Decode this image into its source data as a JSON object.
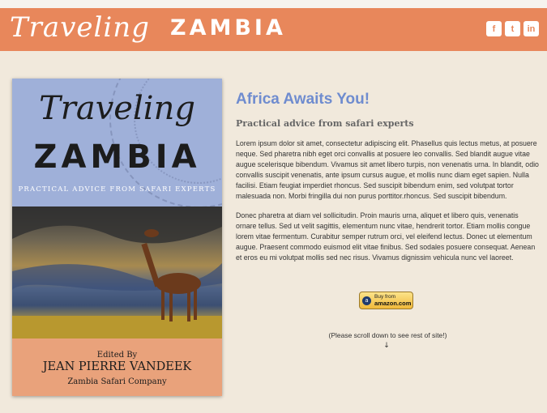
{
  "header": {
    "script_title": "Traveling",
    "title": "ZAMBIA",
    "social": [
      {
        "icon": "facebook-icon",
        "glyph": "f"
      },
      {
        "icon": "twitter-icon",
        "glyph": "t"
      },
      {
        "icon": "linkedin-icon",
        "glyph": "in"
      }
    ]
  },
  "book": {
    "script_title": "Traveling",
    "title": "ZAMBIA",
    "subtitle": "PRACTICAL ADVICE FROM SAFARI EXPERTS",
    "edited_by": "Edited By",
    "author": "JEAN PIERRE VANDEEK",
    "company": "Zambia Safari Company"
  },
  "main": {
    "heading": "Africa Awaits You!",
    "subheading": "Practical advice from safari experts",
    "paragraphs": [
      "Lorem ipsum dolor sit amet, consectetur adipiscing elit. Phasellus quis lectus metus, at posuere neque. Sed pharetra nibh eget orci convallis at posuere leo convallis. Sed blandit augue vitae augue scelerisque bibendum. Vivamus sit amet libero turpis, non venenatis urna. In blandit, odio convallis suscipit venenatis, ante ipsum cursus augue, et mollis nunc diam eget sapien. Nulla facilisi. Etiam feugiat imperdiet rhoncus. Sed suscipit bibendum enim, sed volutpat tortor malesuada non. Morbi fringilla dui non purus porttitor.rhoncus. Sed suscipit bibendum.",
      "Donec pharetra at diam vel sollicitudin. Proin mauris urna, aliquet et libero quis, venenatis ornare tellus. Sed ut velit sagittis, elementum nunc vitae, hendrerit tortor. Etiam mollis congue lorem vitae fermentum. Curabitur semper rutrum orci, vel eleifend lectus. Donec ut elementum augue. Praesent commodo euismod elit vitae finibus. Sed sodales posuere consequat. Aenean et eros eu mi volutpat mollis sed nec risus. Vivamus dignissim vehicula nunc vel laoreet."
    ],
    "buy_button": {
      "line1": "Buy from",
      "line2": "amazon.com"
    },
    "scroll_note": "(Please scroll down to see rest of site!)",
    "scroll_arrow": "↓"
  },
  "colors": {
    "header": "#e8875b",
    "background": "#f1e9dc",
    "heading": "#6f8ccf"
  }
}
